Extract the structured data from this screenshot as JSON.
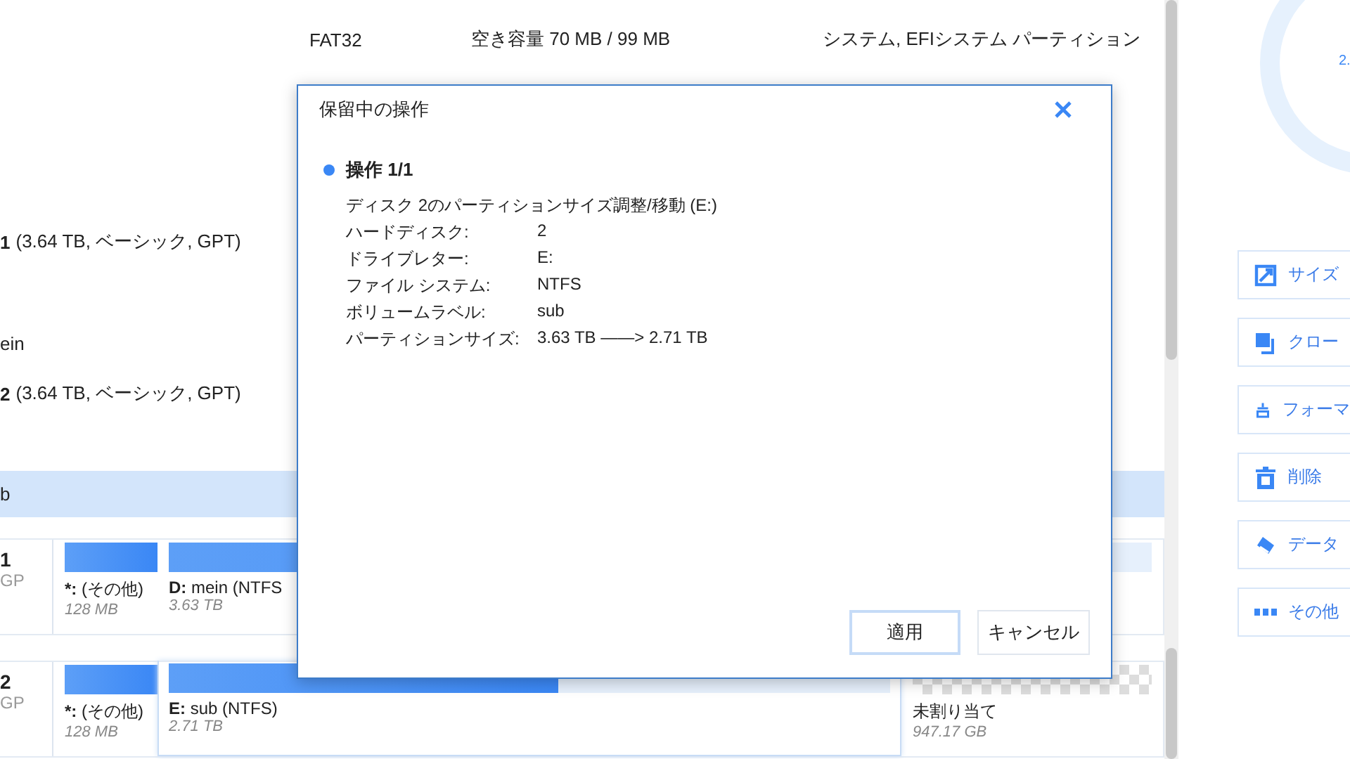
{
  "partition_table": {
    "rows": [
      {
        "kind": "partition",
        "selected": false,
        "file_system": "FAT32",
        "capacity": "空き容量 70 MB / 99 MB",
        "type": "システム, EFIシステム パーティション"
      },
      {
        "kind": "disk",
        "number": "1",
        "info": "(3.64 TB, ベーシック, GPT)"
      },
      {
        "kind": "partition",
        "selected": false,
        "name": "ein"
      },
      {
        "kind": "disk",
        "number": "2",
        "info": "(3.64 TB, ベーシック, GPT)"
      },
      {
        "kind": "partition",
        "selected": true,
        "name": "b"
      }
    ]
  },
  "disk_map": [
    {
      "number": "1",
      "type": "GP",
      "partitions": [
        {
          "kind": "volume",
          "selected": false,
          "drive": "*:",
          "label": "(その他)",
          "size": "128 MB",
          "level": 1
        },
        {
          "kind": "volume",
          "selected": false,
          "drive": "D:",
          "label": "mein (NTFS",
          "size": "3.63 TB",
          "level": 0.9
        }
      ]
    },
    {
      "number": "2",
      "type": "GP",
      "partitions": [
        {
          "kind": "volume",
          "selected": false,
          "drive": "*:",
          "label": "(その他)",
          "size": "128 MB",
          "level": 1
        },
        {
          "kind": "volume",
          "selected": true,
          "drive": "E:",
          "label": "sub (NTFS)",
          "size": "2.71 TB",
          "level": 0.54
        },
        {
          "kind": "unallocated",
          "selected": false,
          "label": "未割り当て",
          "size": "947.17 GB"
        }
      ]
    }
  ],
  "side_panel": {
    "chart_label": "2.",
    "actions": [
      {
        "kind": "resize",
        "label": "サイズ"
      },
      {
        "kind": "clone",
        "label": "クロー"
      },
      {
        "kind": "format",
        "label": "フォーマ"
      },
      {
        "kind": "delete",
        "label": "削除"
      },
      {
        "kind": "wipe",
        "label": "データ"
      },
      {
        "kind": "more",
        "label": "その他"
      }
    ]
  },
  "dialog": {
    "title": "保留中の操作",
    "operation": {
      "heading": "操作 1/1",
      "description": "ディスク 2のパーティションサイズ調整/移動 (E:)",
      "details": [
        {
          "key": "ハードディスク:",
          "value": "2"
        },
        {
          "key": "ドライブレター:",
          "value": "E:"
        },
        {
          "key": "ファイル システム:",
          "value": "NTFS"
        },
        {
          "key": "ボリュームラベル:",
          "value": "sub"
        },
        {
          "key": "パーティションサイズ:",
          "value": "3.63 TB ——> 2.71 TB"
        }
      ]
    },
    "buttons": [
      {
        "label": "適用",
        "selected": true
      },
      {
        "label": "キャンセル",
        "selected": false
      }
    ]
  }
}
